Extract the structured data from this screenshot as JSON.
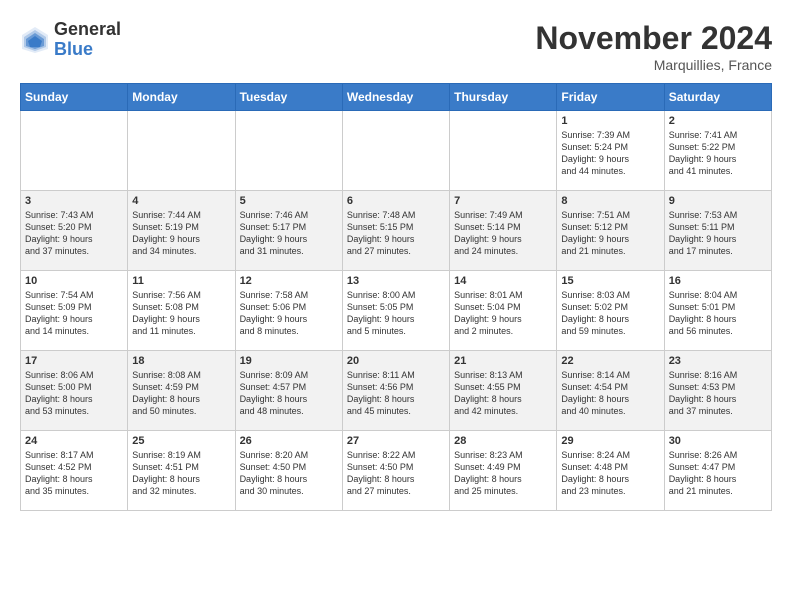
{
  "logo": {
    "general": "General",
    "blue": "Blue"
  },
  "header": {
    "month": "November 2024",
    "location": "Marquillies, France"
  },
  "days_of_week": [
    "Sunday",
    "Monday",
    "Tuesday",
    "Wednesday",
    "Thursday",
    "Friday",
    "Saturday"
  ],
  "weeks": [
    [
      {
        "day": "",
        "info": ""
      },
      {
        "day": "",
        "info": ""
      },
      {
        "day": "",
        "info": ""
      },
      {
        "day": "",
        "info": ""
      },
      {
        "day": "",
        "info": ""
      },
      {
        "day": "1",
        "info": "Sunrise: 7:39 AM\nSunset: 5:24 PM\nDaylight: 9 hours\nand 44 minutes."
      },
      {
        "day": "2",
        "info": "Sunrise: 7:41 AM\nSunset: 5:22 PM\nDaylight: 9 hours\nand 41 minutes."
      }
    ],
    [
      {
        "day": "3",
        "info": "Sunrise: 7:43 AM\nSunset: 5:20 PM\nDaylight: 9 hours\nand 37 minutes."
      },
      {
        "day": "4",
        "info": "Sunrise: 7:44 AM\nSunset: 5:19 PM\nDaylight: 9 hours\nand 34 minutes."
      },
      {
        "day": "5",
        "info": "Sunrise: 7:46 AM\nSunset: 5:17 PM\nDaylight: 9 hours\nand 31 minutes."
      },
      {
        "day": "6",
        "info": "Sunrise: 7:48 AM\nSunset: 5:15 PM\nDaylight: 9 hours\nand 27 minutes."
      },
      {
        "day": "7",
        "info": "Sunrise: 7:49 AM\nSunset: 5:14 PM\nDaylight: 9 hours\nand 24 minutes."
      },
      {
        "day": "8",
        "info": "Sunrise: 7:51 AM\nSunset: 5:12 PM\nDaylight: 9 hours\nand 21 minutes."
      },
      {
        "day": "9",
        "info": "Sunrise: 7:53 AM\nSunset: 5:11 PM\nDaylight: 9 hours\nand 17 minutes."
      }
    ],
    [
      {
        "day": "10",
        "info": "Sunrise: 7:54 AM\nSunset: 5:09 PM\nDaylight: 9 hours\nand 14 minutes."
      },
      {
        "day": "11",
        "info": "Sunrise: 7:56 AM\nSunset: 5:08 PM\nDaylight: 9 hours\nand 11 minutes."
      },
      {
        "day": "12",
        "info": "Sunrise: 7:58 AM\nSunset: 5:06 PM\nDaylight: 9 hours\nand 8 minutes."
      },
      {
        "day": "13",
        "info": "Sunrise: 8:00 AM\nSunset: 5:05 PM\nDaylight: 9 hours\nand 5 minutes."
      },
      {
        "day": "14",
        "info": "Sunrise: 8:01 AM\nSunset: 5:04 PM\nDaylight: 9 hours\nand 2 minutes."
      },
      {
        "day": "15",
        "info": "Sunrise: 8:03 AM\nSunset: 5:02 PM\nDaylight: 8 hours\nand 59 minutes."
      },
      {
        "day": "16",
        "info": "Sunrise: 8:04 AM\nSunset: 5:01 PM\nDaylight: 8 hours\nand 56 minutes."
      }
    ],
    [
      {
        "day": "17",
        "info": "Sunrise: 8:06 AM\nSunset: 5:00 PM\nDaylight: 8 hours\nand 53 minutes."
      },
      {
        "day": "18",
        "info": "Sunrise: 8:08 AM\nSunset: 4:59 PM\nDaylight: 8 hours\nand 50 minutes."
      },
      {
        "day": "19",
        "info": "Sunrise: 8:09 AM\nSunset: 4:57 PM\nDaylight: 8 hours\nand 48 minutes."
      },
      {
        "day": "20",
        "info": "Sunrise: 8:11 AM\nSunset: 4:56 PM\nDaylight: 8 hours\nand 45 minutes."
      },
      {
        "day": "21",
        "info": "Sunrise: 8:13 AM\nSunset: 4:55 PM\nDaylight: 8 hours\nand 42 minutes."
      },
      {
        "day": "22",
        "info": "Sunrise: 8:14 AM\nSunset: 4:54 PM\nDaylight: 8 hours\nand 40 minutes."
      },
      {
        "day": "23",
        "info": "Sunrise: 8:16 AM\nSunset: 4:53 PM\nDaylight: 8 hours\nand 37 minutes."
      }
    ],
    [
      {
        "day": "24",
        "info": "Sunrise: 8:17 AM\nSunset: 4:52 PM\nDaylight: 8 hours\nand 35 minutes."
      },
      {
        "day": "25",
        "info": "Sunrise: 8:19 AM\nSunset: 4:51 PM\nDaylight: 8 hours\nand 32 minutes."
      },
      {
        "day": "26",
        "info": "Sunrise: 8:20 AM\nSunset: 4:50 PM\nDaylight: 8 hours\nand 30 minutes."
      },
      {
        "day": "27",
        "info": "Sunrise: 8:22 AM\nSunset: 4:50 PM\nDaylight: 8 hours\nand 27 minutes."
      },
      {
        "day": "28",
        "info": "Sunrise: 8:23 AM\nSunset: 4:49 PM\nDaylight: 8 hours\nand 25 minutes."
      },
      {
        "day": "29",
        "info": "Sunrise: 8:24 AM\nSunset: 4:48 PM\nDaylight: 8 hours\nand 23 minutes."
      },
      {
        "day": "30",
        "info": "Sunrise: 8:26 AM\nSunset: 4:47 PM\nDaylight: 8 hours\nand 21 minutes."
      }
    ]
  ]
}
